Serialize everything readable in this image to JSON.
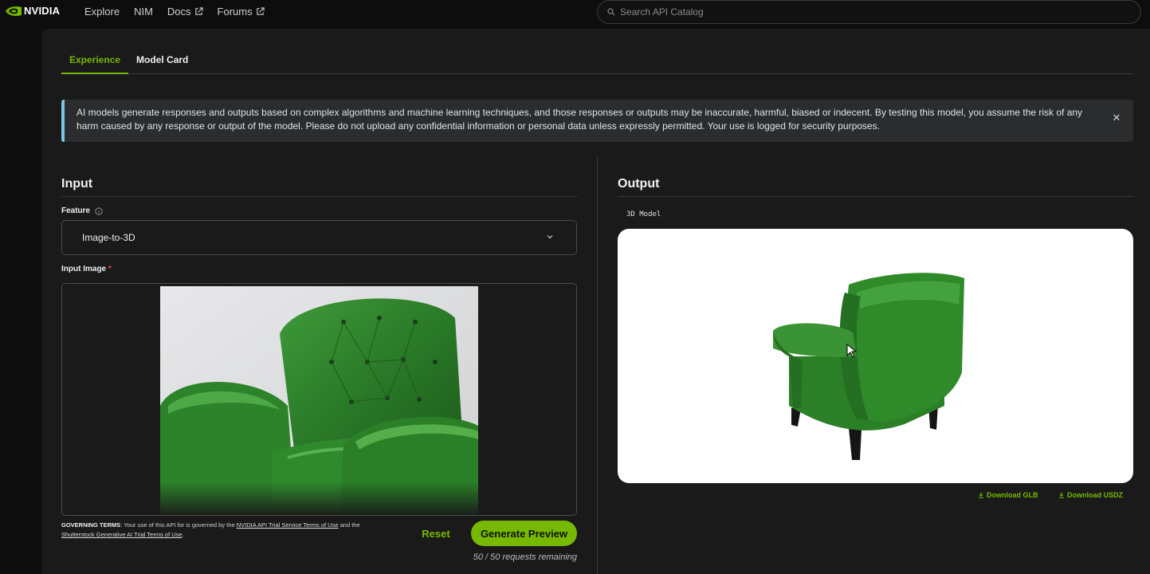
{
  "brand": {
    "name": "NVIDIA",
    "accent": "#76b900"
  },
  "nav": {
    "items": [
      {
        "label": "Explore"
      },
      {
        "label": "NIM"
      },
      {
        "label": "Docs",
        "external": true
      },
      {
        "label": "Forums",
        "external": true
      }
    ]
  },
  "search": {
    "placeholder": "Search API Catalog"
  },
  "tabs": [
    {
      "label": "Experience",
      "active": true
    },
    {
      "label": "Model Card",
      "active": false
    }
  ],
  "notice": {
    "text": "AI models generate responses and outputs based on complex algorithms and machine learning techniques, and those responses or outputs may be inaccurate, harmful, biased or indecent. By testing this model, you assume the risk of any harm caused by any response or output of the model. Please do not upload any confidential information or personal data unless expressly permitted. Your use is logged for security purposes.",
    "close_icon": "close-icon"
  },
  "input": {
    "title": "Input",
    "feature_label": "Feature",
    "feature_value": "Image-to-3D",
    "image_label": "Input Image",
    "required_mark": "*"
  },
  "governing": {
    "prefix": "GOVERNING TERMS",
    "text1": ": Your use of this API for is governed by the ",
    "link1": "NVIDIA API Trial Service Terms of Use",
    "text2": " and the ",
    "link2": "Shutterstock Generative AI Trial Terms of Use",
    "text3": "."
  },
  "actions": {
    "reset": "Reset",
    "generate": "Generate Preview",
    "remaining": "50 / 50 requests remaining"
  },
  "output": {
    "title": "Output",
    "model_label": "3D Model",
    "download_glb": "Download GLB",
    "download_usdz": "Download USDZ"
  }
}
